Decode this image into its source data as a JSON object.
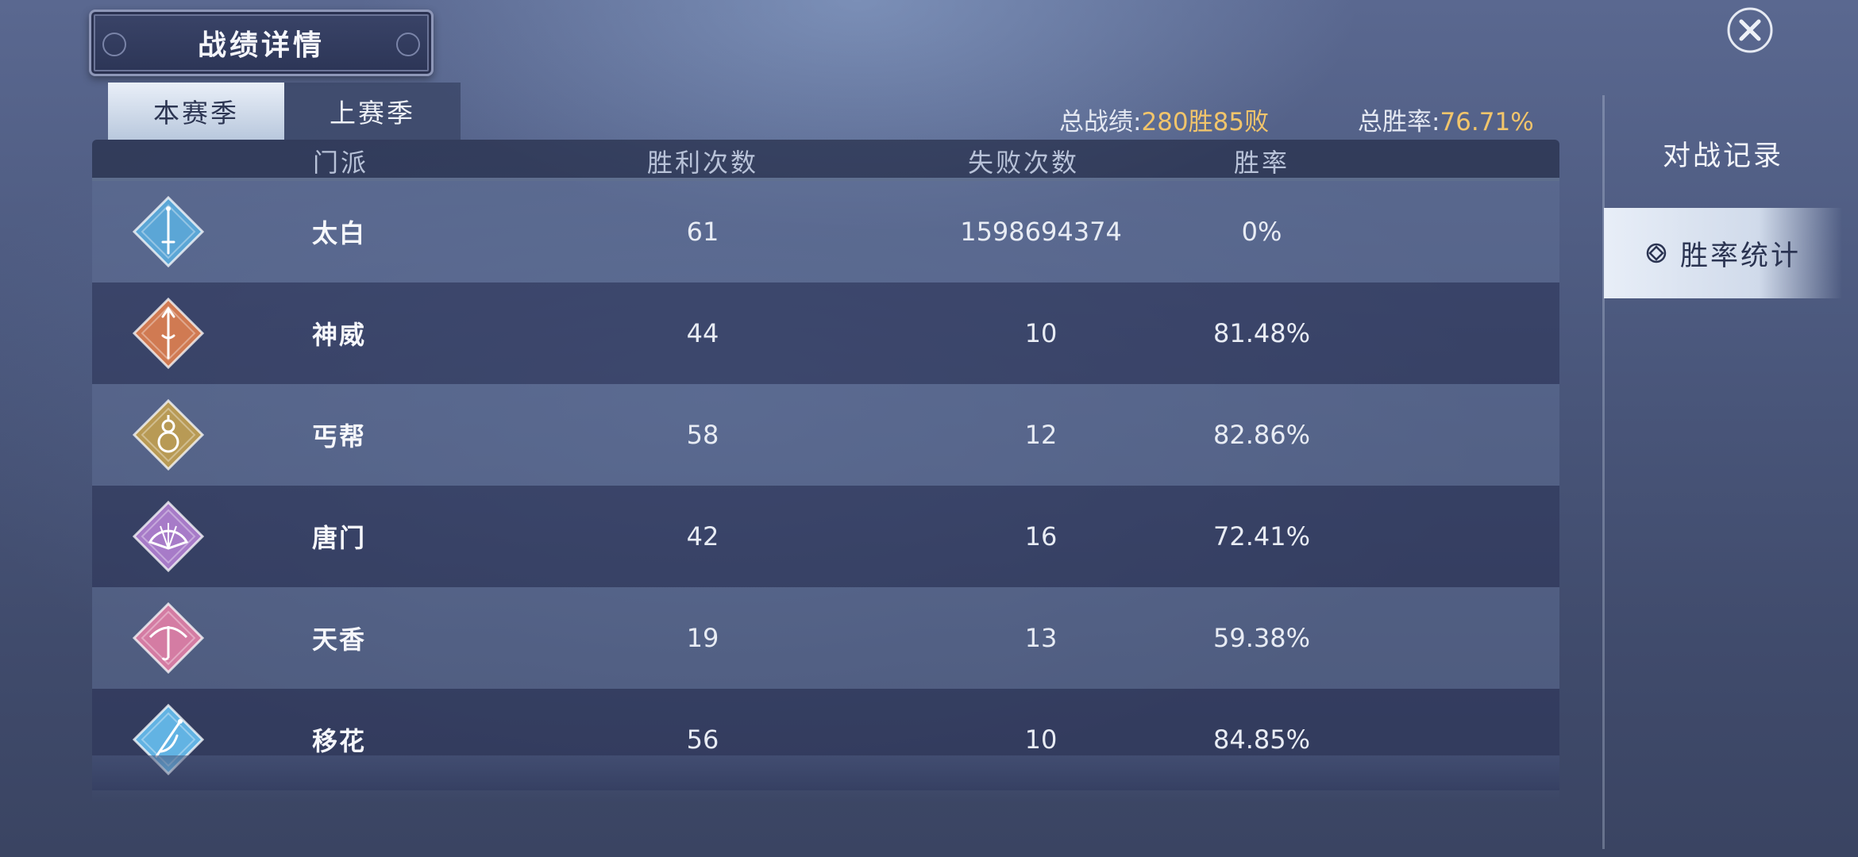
{
  "header": {
    "title": "战绩详情"
  },
  "tabs": [
    {
      "label": "本赛季",
      "active": true
    },
    {
      "label": "上赛季",
      "active": false
    }
  ],
  "summary": {
    "record_label": "总战绩:",
    "record_value": "280胜85败",
    "rate_label": "总胜率:",
    "rate_value": "76.71%"
  },
  "table": {
    "headers": {
      "sect": "门派",
      "wins": "胜利次数",
      "losses": "失败次数",
      "rate": "胜率"
    },
    "rows": [
      {
        "sect": "太白",
        "wins": "61",
        "losses": "1598694374",
        "rate": "0%",
        "icon": "sword-icon",
        "color": "#5ba6d6"
      },
      {
        "sect": "神威",
        "wins": "44",
        "losses": "10",
        "rate": "81.48%",
        "icon": "spear-icon",
        "color": "#d07a52"
      },
      {
        "sect": "丐帮",
        "wins": "58",
        "losses": "12",
        "rate": "82.86%",
        "icon": "gourd-icon",
        "color": "#b89a55"
      },
      {
        "sect": "唐门",
        "wins": "42",
        "losses": "16",
        "rate": "72.41%",
        "icon": "fan-icon",
        "color": "#a77bc8"
      },
      {
        "sect": "天香",
        "wins": "19",
        "losses": "13",
        "rate": "59.38%",
        "icon": "umbrella-icon",
        "color": "#d47ca3"
      },
      {
        "sect": "移花",
        "wins": "56",
        "losses": "10",
        "rate": "84.85%",
        "icon": "flower-blade-icon",
        "color": "#62b3e3"
      }
    ]
  },
  "sidebar": {
    "items": [
      {
        "label": "对战记录",
        "active": false
      },
      {
        "label": "胜率统计",
        "active": true
      }
    ]
  },
  "colors": {
    "accent": "#f2c56b"
  }
}
